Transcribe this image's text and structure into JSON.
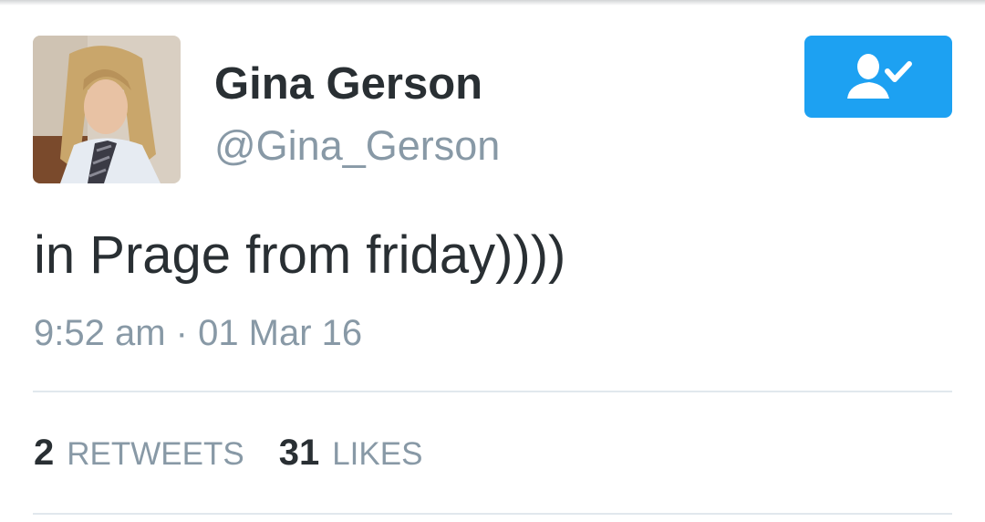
{
  "user": {
    "display_name": "Gina Gerson",
    "handle": "@Gina_Gerson"
  },
  "follow_button": {
    "icon": "user-following-check-icon",
    "color": "#1da1f2"
  },
  "tweet": {
    "text": "in Prage from friday))))",
    "timestamp": "9:52 am · 01 Mar 16"
  },
  "stats": {
    "retweets_count": "2",
    "retweets_label": "RETWEETS",
    "likes_count": "31",
    "likes_label": "LIKES"
  },
  "colors": {
    "text_primary": "#292f33",
    "text_secondary": "#8899a6",
    "divider": "#e1e8ed",
    "accent": "#1da1f2"
  }
}
